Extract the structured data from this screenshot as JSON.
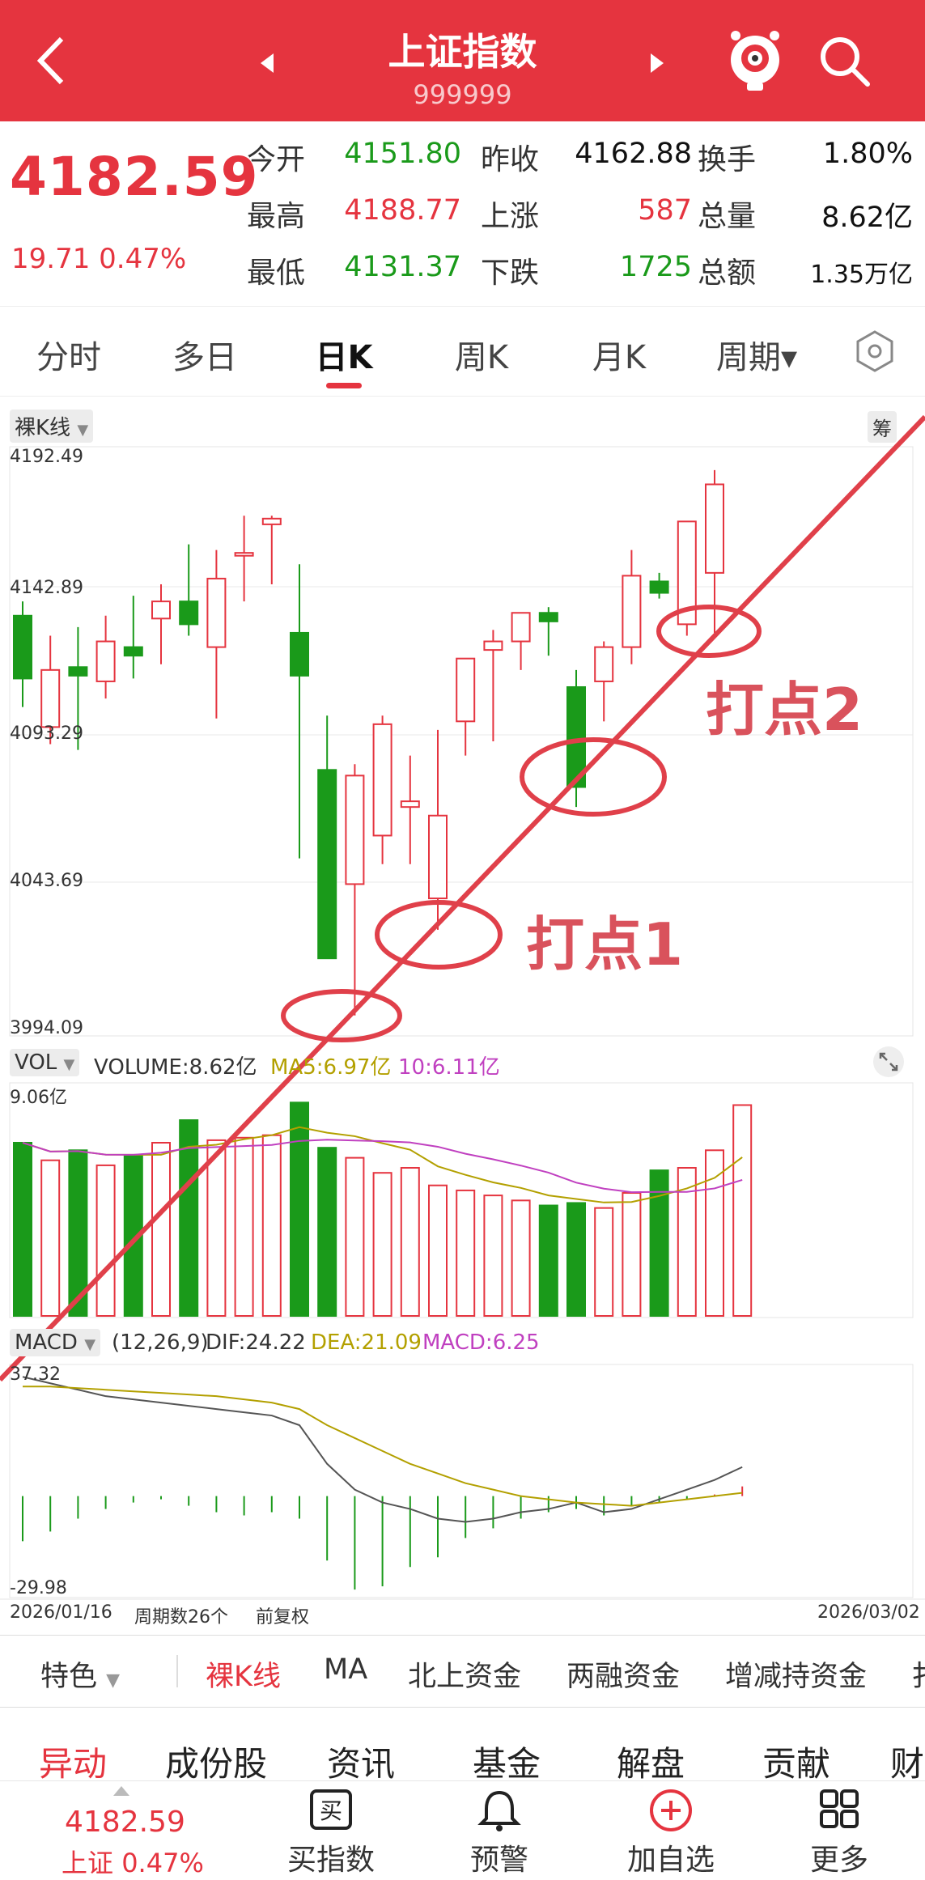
{
  "header": {
    "title": "上证指数",
    "code": "999999",
    "back_icon": "chevron-left-icon",
    "prev_icon": "triangle-left-icon",
    "next_icon": "triangle-right-icon",
    "mascot_icon": "mascot-icon",
    "search_icon": "search-icon"
  },
  "quote": {
    "price": "4182.59",
    "change": "19.71",
    "change_pct": "0.47%",
    "rows": [
      [
        {
          "label": "今开",
          "value": "4151.80",
          "color": "green"
        },
        {
          "label": "昨收",
          "value": "4162.88",
          "color": "blk"
        },
        {
          "label": "换手",
          "value": "1.80%",
          "color": "blk"
        }
      ],
      [
        {
          "label": "最高",
          "value": "4188.77",
          "color": "red"
        },
        {
          "label": "上涨",
          "value": "587",
          "color": "red"
        },
        {
          "label": "总量",
          "value": "8.62亿",
          "color": "blk"
        }
      ],
      [
        {
          "label": "最低",
          "value": "4131.37",
          "color": "green"
        },
        {
          "label": "下跌",
          "value": "1725",
          "color": "green"
        },
        {
          "label": "总额",
          "value": "1.35万亿",
          "color": "blk"
        }
      ]
    ]
  },
  "tabs": [
    {
      "label": "分时"
    },
    {
      "label": "多日"
    },
    {
      "label": "日K"
    },
    {
      "label": "周K"
    },
    {
      "label": "月K"
    },
    {
      "label": "周期▾"
    }
  ],
  "settings_icon": "hexagon-settings-icon",
  "kline": {
    "mode_label": "裸K线",
    "chip_label": "筹",
    "ylabels": [
      "4192.49",
      "4142.89",
      "4093.29",
      "4043.69",
      "3994.09"
    ]
  },
  "vol": {
    "title": "VOL",
    "volume_label": "VOLUME:8.62亿",
    "ma5_label": "MA5:6.97亿",
    "ma10_label": "10:6.11亿",
    "ymax": "9.06亿",
    "expand_icon": "expand-icon"
  },
  "macd": {
    "title": "MACD",
    "params": "(12,26,9)",
    "dif": "DIF:24.22",
    "dea": "DEA:21.09",
    "macd": "MACD:6.25",
    "ymax": "37.32",
    "ymin": "-29.98"
  },
  "footer_info": {
    "start_date": "2026/01/16",
    "count": "周期数26个",
    "adjust": "前复权",
    "end_date": "2026/03/02"
  },
  "annotations": {
    "point1": "打点1",
    "point2": "打点2"
  },
  "chart_data": {
    "type": "candlestick",
    "ylim": [
      3994.09,
      4192.49
    ],
    "candles": [
      {
        "o": 4137,
        "h": 4142,
        "l": 4105,
        "c": 4115
      },
      {
        "o": 4098,
        "h": 4130,
        "l": 4092,
        "c": 4118
      },
      {
        "o": 4119,
        "h": 4133,
        "l": 4090,
        "c": 4116
      },
      {
        "o": 4114,
        "h": 4137,
        "l": 4108,
        "c": 4128
      },
      {
        "o": 4126,
        "h": 4144,
        "l": 4115,
        "c": 4123
      },
      {
        "o": 4136,
        "h": 4148,
        "l": 4120,
        "c": 4142
      },
      {
        "o": 4142,
        "h": 4162,
        "l": 4130,
        "c": 4134
      },
      {
        "o": 4126,
        "h": 4160,
        "l": 4101,
        "c": 4150
      },
      {
        "o": 4158,
        "h": 4172,
        "l": 4142,
        "c": 4159
      },
      {
        "o": 4169,
        "h": 4172,
        "l": 4148,
        "c": 4171
      },
      {
        "o": 4131,
        "h": 4155,
        "l": 4052,
        "c": 4116
      },
      {
        "o": 4083,
        "h": 4102,
        "l": 4018,
        "c": 4017
      },
      {
        "o": 4043,
        "h": 4085,
        "l": 3997,
        "c": 4081
      },
      {
        "o": 4060,
        "h": 4102,
        "l": 4050,
        "c": 4099
      },
      {
        "o": 4070,
        "h": 4088,
        "l": 4050,
        "c": 4072
      },
      {
        "o": 4038,
        "h": 4097,
        "l": 4027,
        "c": 4067
      },
      {
        "o": 4100,
        "h": 4122,
        "l": 4088,
        "c": 4122
      },
      {
        "o": 4125,
        "h": 4132,
        "l": 4093,
        "c": 4128
      },
      {
        "o": 4128,
        "h": 4138,
        "l": 4118,
        "c": 4138
      },
      {
        "o": 4138,
        "h": 4140,
        "l": 4123,
        "c": 4135
      },
      {
        "o": 4112,
        "h": 4118,
        "l": 4070,
        "c": 4077
      },
      {
        "o": 4114,
        "h": 4128,
        "l": 4100,
        "c": 4126
      },
      {
        "o": 4126,
        "h": 4160,
        "l": 4120,
        "c": 4151
      },
      {
        "o": 4149,
        "h": 4152,
        "l": 4143,
        "c": 4145
      },
      {
        "o": 4134,
        "h": 4164,
        "l": 4130,
        "c": 4170
      },
      {
        "o": 4152,
        "h": 4188,
        "l": 4131,
        "c": 4183
      }
    ],
    "volumes": [
      6.9,
      6.2,
      6.6,
      6.0,
      6.4,
      6.9,
      7.8,
      7.0,
      7.1,
      7.2,
      8.5,
      6.7,
      6.3,
      5.7,
      5.9,
      5.2,
      5.0,
      4.8,
      4.6,
      4.4,
      4.5,
      4.3,
      4.9,
      5.8,
      5.9,
      6.6,
      8.4
    ],
    "vol_ylim": [
      0,
      9.06
    ],
    "macd_hist": [
      -14,
      -11,
      -7,
      -4,
      -2,
      -1,
      -3,
      -5,
      -6,
      -5,
      -7,
      -20,
      -29,
      -28,
      -22,
      -19,
      -13,
      -10,
      -7,
      -5,
      -4,
      -6,
      -3,
      -2,
      -1,
      0.5,
      3
    ],
    "dif": [
      37,
      35,
      33,
      31,
      30,
      29,
      28,
      27,
      26,
      25,
      22,
      10,
      2,
      -2,
      -4,
      -7,
      -8,
      -7,
      -5,
      -4,
      -2,
      -5,
      -4,
      -1,
      2,
      5,
      9
    ],
    "dea": [
      34,
      34,
      33.5,
      33,
      32.5,
      32,
      31.5,
      31,
      30,
      29,
      27,
      22,
      18,
      14,
      10,
      7,
      4,
      2,
      0,
      -1,
      -2,
      -2.5,
      -3,
      -2,
      -1,
      0,
      1
    ],
    "macd_ylim": [
      -29.98,
      37.32
    ]
  }
}
